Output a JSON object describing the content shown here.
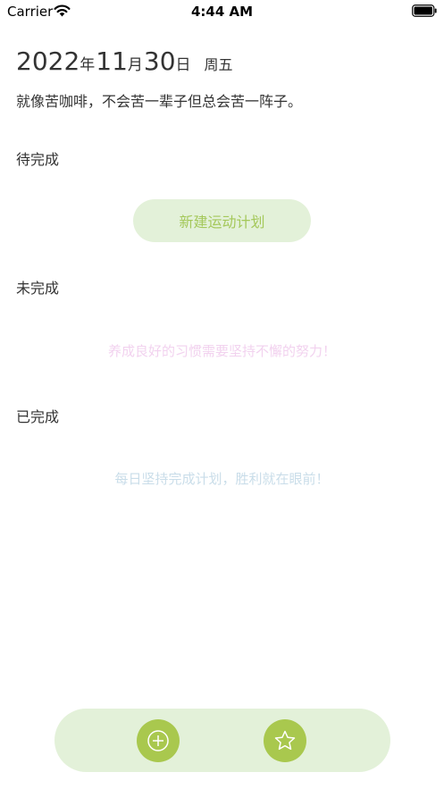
{
  "status_bar": {
    "carrier": "Carrier",
    "time": "4:44 AM"
  },
  "header": {
    "year": "2022",
    "year_unit": "年",
    "month": "11",
    "month_unit": "月",
    "day": "30",
    "day_unit": "日",
    "weekday": "周五",
    "quote": "就像苦咖啡，不会苦一辈子但总会苦一阵子。"
  },
  "sections": {
    "pending_title": "待完成",
    "new_plan_label": "新建运动计划",
    "incomplete_title": "未完成",
    "incomplete_hint": "养成良好的习惯需要坚持不懈的努力！",
    "completed_title": "已完成",
    "completed_hint": "每日坚持完成计划，胜利就在眼前！"
  },
  "bottom_bar": {
    "left_icon": "plus-circle-icon",
    "right_icon": "star-icon"
  },
  "colors": {
    "accent": "#a9c84e",
    "accent_light": "#e3f1d9",
    "accent_text": "#a4c85a",
    "hint_pink": "#f2d2ef",
    "hint_blue": "#c9dde9"
  }
}
